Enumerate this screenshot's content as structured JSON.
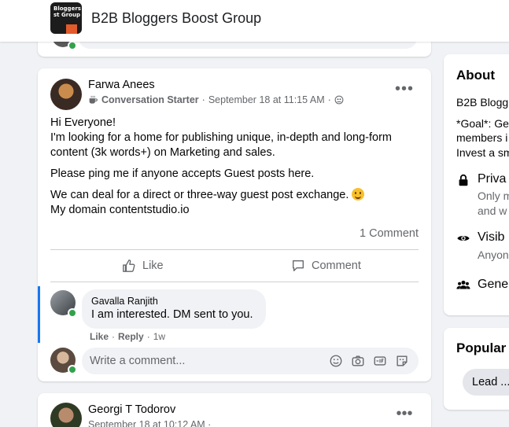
{
  "header": {
    "group_name": "B2B Bloggers Boost Group",
    "group_thumb_text": "Bloggers\nst Group"
  },
  "post": {
    "author": "Farwa Anees",
    "badge": "Conversation Starter",
    "timestamp": "September 18 at 11:15 AM",
    "separator": "·",
    "body": [
      "Hi Everyone!",
      "I'm looking for a home for publishing unique, in-depth and long-form content (3k words+) on Marketing and sales.",
      "Please ping me if anyone accepts Guest posts here.",
      "We can deal for a direct or three-way guest post exchange.",
      "My domain contentstudio.io"
    ],
    "comment_count": "1 Comment",
    "like_label": "Like",
    "comment_label": "Comment",
    "more_label": "•••"
  },
  "comment": {
    "author": "Gavalla Ranjith",
    "text": "I am interested. DM sent to you.",
    "like": "Like",
    "reply": "Reply",
    "dot": "·",
    "age": "1w"
  },
  "write_comment": {
    "placeholder": "Write a comment..."
  },
  "next_post": {
    "author": "Georgi T Todorov",
    "timestamp": "September 18 at 10:12 AM ·",
    "more_label": "•••"
  },
  "about": {
    "title": "About",
    "line1": "B2B Blogg",
    "line2": "*Goal*: Ge",
    "line3": "members i",
    "line4": "Invest a sm",
    "privacy_title": "Priva",
    "privacy_sub1": "Only m",
    "privacy_sub2": "and w",
    "visible_title": "Visib",
    "visible_sub": "Anyon",
    "general_title": "Gene"
  },
  "popular": {
    "title": "Popular T",
    "chip": "Lead ..."
  },
  "colors": {
    "accent": "#1877f2",
    "online": "#31a24c",
    "muted": "#65676b",
    "background": "#f0f2f5"
  }
}
